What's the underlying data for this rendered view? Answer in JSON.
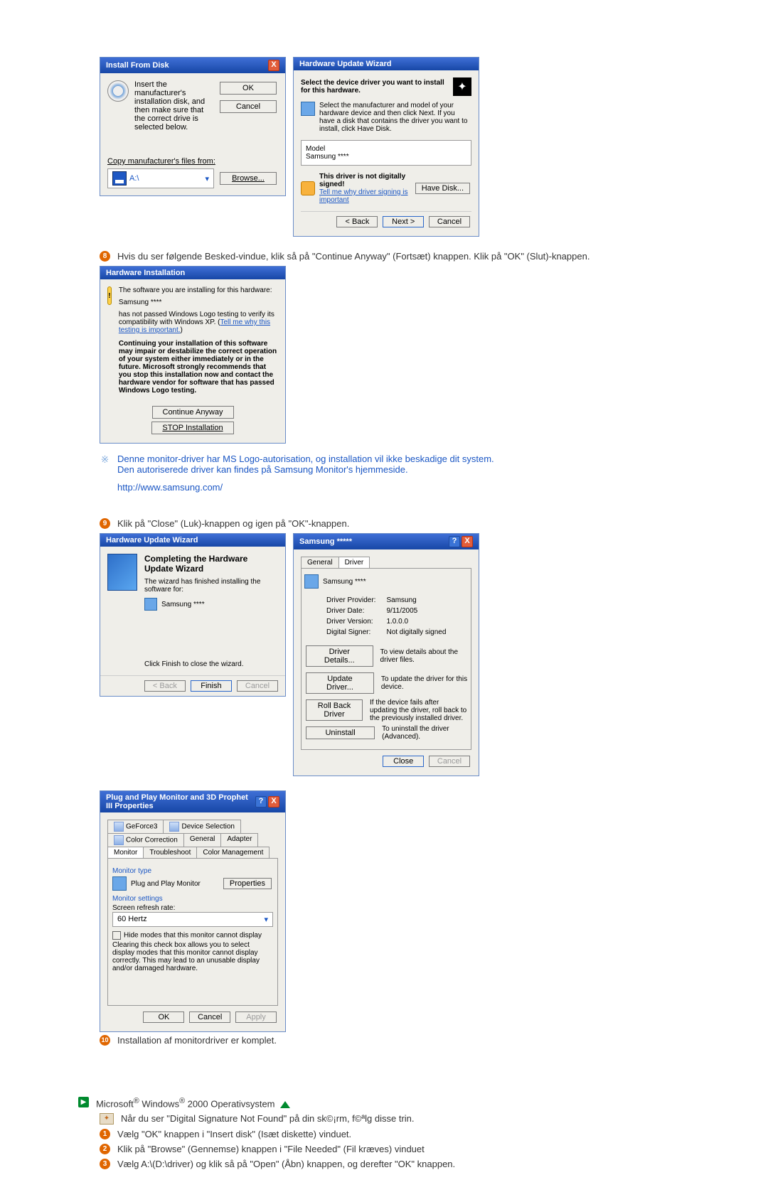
{
  "install_from_disk": {
    "title": "Install From Disk",
    "instruction": "Insert the manufacturer's installation disk, and then make sure that the correct drive is selected below.",
    "ok": "OK",
    "cancel": "Cancel",
    "copy_label": "Copy manufacturer's files from:",
    "path": "A:\\",
    "browse": "Browse..."
  },
  "hw_update_select": {
    "title": "Hardware Update Wizard",
    "heading": "Select the device driver you want to install for this hardware.",
    "sub": "Select the manufacturer and model of your hardware device and then click Next. If you have a disk that contains the driver you want to install, click Have Disk.",
    "model_label": "Model",
    "model_value": "Samsung ****",
    "not_signed": "This driver is not digitally signed!",
    "tell_me": "Tell me why driver signing is important",
    "have_disk": "Have Disk...",
    "back": "< Back",
    "next": "Next >",
    "cancel": "Cancel"
  },
  "step8": "Hvis du ser følgende Besked-vindue, klik så på \"Continue Anyway\" (Fortsæt) knappen. Klik på \"OK\" (Slut)-knappen.",
  "hw_install_warn": {
    "title": "Hardware Installation",
    "l1": "The software you are installing for this hardware:",
    "l2": "Samsung ****",
    "l3": "has not passed Windows Logo testing to verify its compatibility with Windows XP. (",
    "l3link": "Tell me why this testing is important.",
    "l3end": ")",
    "bold": "Continuing your installation of this software may impair or destabilize the correct operation of your system either immediately or in the future. Microsoft strongly recommends that you stop this installation now and contact the hardware vendor for software that has passed Windows Logo testing.",
    "cont": "Continue Anyway",
    "stop": "STOP Installation"
  },
  "note1": "Denne monitor-driver har MS Logo-autorisation, og installation vil ikke beskadige dit system.",
  "note2": "Den autoriserede driver kan findes på Samsung Monitor's hjemmeside.",
  "url": "http://www.samsung.com/",
  "step9": "Klik på \"Close\" (Luk)-knappen og igen på \"OK\"-knappen.",
  "hw_complete": {
    "title": "Hardware Update Wizard",
    "heading": "Completing the Hardware Update Wizard",
    "sub": "The wizard has finished installing the software for:",
    "dev": "Samsung ****",
    "hint": "Click Finish to close the wizard.",
    "back": "< Back",
    "finish": "Finish",
    "cancel": "Cancel"
  },
  "driver_props": {
    "title": "Samsung *****",
    "tab_general": "General",
    "tab_driver": "Driver",
    "dev": "Samsung ****",
    "provider_l": "Driver Provider:",
    "provider_v": "Samsung",
    "date_l": "Driver Date:",
    "date_v": "9/11/2005",
    "ver_l": "Driver Version:",
    "ver_v": "1.0.0.0",
    "sign_l": "Digital Signer:",
    "sign_v": "Not digitally signed",
    "b1": "Driver Details...",
    "b1d": "To view details about the driver files.",
    "b2": "Update Driver...",
    "b2d": "To update the driver for this device.",
    "b3": "Roll Back Driver",
    "b3d": "If the device fails after updating the driver, roll back to the previously installed driver.",
    "b4": "Uninstall",
    "b4d": "To uninstall the driver (Advanced).",
    "close": "Close",
    "cancel": "Cancel"
  },
  "pnp": {
    "title": "Plug and Play Monitor and 3D Prophet III Properties",
    "tabs": {
      "geforce": "GeForce3",
      "device": "Device Selection",
      "color": "Color Correction",
      "general": "General",
      "adapter": "Adapter",
      "monitor": "Monitor",
      "trouble": "Troubleshoot",
      "colmgmt": "Color Management"
    },
    "mtype_h": "Monitor type",
    "mtype_v": "Plug and Play Monitor",
    "properties": "Properties",
    "mset_h": "Monitor settings",
    "refresh_l": "Screen refresh rate:",
    "refresh_v": "60 Hertz",
    "hide": "Hide modes that this monitor cannot display",
    "hide_desc": "Clearing this check box allows you to select display modes that this monitor cannot display correctly. This may lead to an unusable display and/or damaged hardware.",
    "ok": "OK",
    "cancel": "Cancel",
    "apply": "Apply"
  },
  "step10": "Installation af monitordriver er komplet.",
  "os_line_pre": "Microsoft",
  "os_line_mid": " Windows",
  "os_line_end": " 2000 Operativsystem",
  "w2k_intro": "Når du ser \"Digital Signature Not Found\" på din sk©¡rm, f©ªlg disse trin.",
  "w2k_1": "Vælg \"OK\" knappen i \"Insert disk\" (Isæt diskette) vinduet.",
  "w2k_2": "Klik på \"Browse\" (Gennemse) knappen i \"File Needed\" (Fil kræves) vinduet",
  "w2k_3": "Vælg A:\\(D:\\driver) og klik så på \"Open\" (Åbn) knappen, og derefter \"OK\" knappen."
}
